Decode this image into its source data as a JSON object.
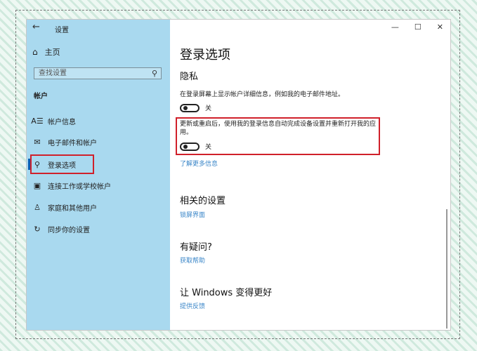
{
  "window": {
    "app_title": "设置",
    "controls": {
      "back": "←",
      "minimize": "—",
      "maximize": "☐",
      "close": "✕"
    }
  },
  "sidebar": {
    "home_icon": "⌂",
    "home_label": "主页",
    "search_placeholder": "查找设置",
    "search_icon": "⚲",
    "section_label": "帐户",
    "items": [
      {
        "icon": "A☰",
        "icon_name": "account-info-icon",
        "label": "帐户信息"
      },
      {
        "icon": "✉",
        "icon_name": "mail-icon",
        "label": "电子邮件和帐户"
      },
      {
        "icon": "⚲",
        "icon_name": "key-icon",
        "label": "登录选项"
      },
      {
        "icon": "▣",
        "icon_name": "briefcase-icon",
        "label": "连接工作或学校帐户"
      },
      {
        "icon": "♙",
        "icon_name": "person-icon",
        "label": "家庭和其他用户"
      },
      {
        "icon": "↻",
        "icon_name": "sync-icon",
        "label": "同步你的设置"
      }
    ]
  },
  "content": {
    "title": "登录选项",
    "privacy": {
      "heading": "隐私",
      "setting1_desc": "在登录屏幕上显示帐户详细信息，例如我的电子邮件地址。",
      "setting1_state": "关",
      "setting2_desc": "更新或重启后，使用我的登录信息自动完成设备设置并重新打开我的应用。",
      "setting2_state": "关",
      "learn_more": "了解更多信息"
    },
    "related": {
      "heading": "相关的设置",
      "link": "锁屏界面"
    },
    "question": {
      "heading": "有疑问?",
      "link": "获取帮助"
    },
    "improve": {
      "heading": "让 Windows 变得更好",
      "link": "提供反馈"
    }
  },
  "colors": {
    "sidebar_bg": "#a9d9ef",
    "accent": "#0a5fb4",
    "link": "#3a86c8",
    "highlight_box": "#d0202a"
  }
}
